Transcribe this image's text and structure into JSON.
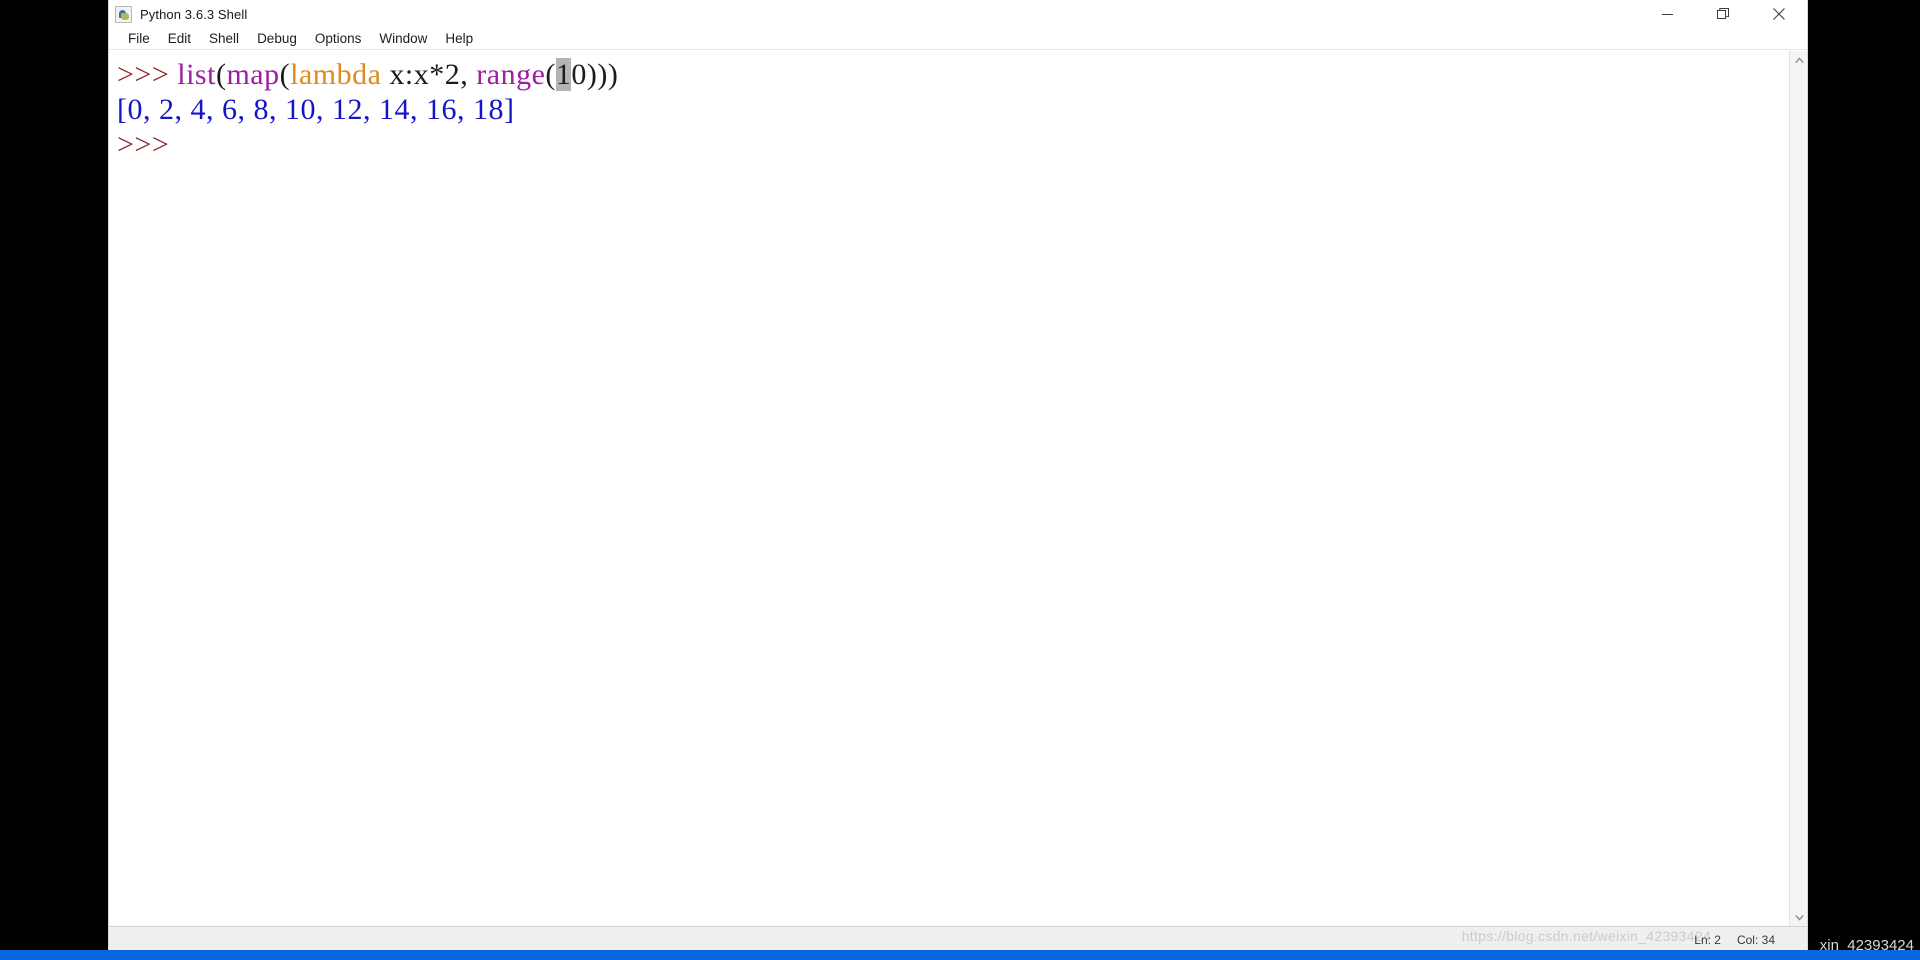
{
  "window": {
    "title": "Python 3.6.3 Shell",
    "icon": "python-idle-icon",
    "controls": {
      "minimize_label": "—",
      "restore_label": "❐",
      "close_label": "✕"
    }
  },
  "menu": {
    "items": [
      {
        "label": "File"
      },
      {
        "label": "Edit"
      },
      {
        "label": "Shell"
      },
      {
        "label": "Debug"
      },
      {
        "label": "Options"
      },
      {
        "label": "Window"
      },
      {
        "label": "Help"
      }
    ]
  },
  "shell": {
    "line1": {
      "prompt": ">>> ",
      "t1": "list",
      "t2": "(",
      "t3": "map",
      "t4": "(",
      "t5": "lambda",
      "t6": " x:x*2, ",
      "t7": "range",
      "t8": "(",
      "t9_selected": "1",
      "t10": "0)))"
    },
    "line2": {
      "output": "[0, 2, 4, 6, 8, 10, 12, 14, 16, 18]"
    },
    "line3": {
      "prompt": ">>>"
    }
  },
  "scrollbar": {
    "up_arrow": "▲",
    "down_arrow": "▼"
  },
  "status": {
    "line": "Ln: 2",
    "col": "Col: 34"
  },
  "watermark": {
    "url": "https://blog.csdn.net/weixin_42393424",
    "handle": "xin_42393424"
  },
  "colors": {
    "builtin": "#9d1fa0",
    "keyword": "#e08a20",
    "prompt": "#8b2b2b",
    "output": "#1515c8",
    "selection": "#b4b4b4",
    "taskbar": "#0a66e0",
    "letterbox": "#000000"
  }
}
